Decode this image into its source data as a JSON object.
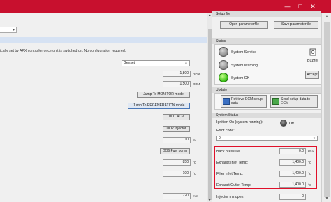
{
  "window": {
    "min_glyph": "—",
    "max_glyph": "□",
    "close_glyph": "✕"
  },
  "left": {
    "info_text": "ically set by APX controller once unit is switched on. No configuration required.",
    "select_value": "Genset",
    "rows": [
      {
        "value": "1,800",
        "unit": "RPM"
      },
      {
        "value": "1,500",
        "unit": "RPM"
      }
    ],
    "jump_monitor": "Jump To MONITOR mode",
    "jump_regeneration": "Jump To REGENERATION mode",
    "do1": "DO1 ACV",
    "do2": "DO2 Injector",
    "percent_value": "10",
    "percent_unit": "%",
    "do6": "DO6 Fuel pump",
    "temp1_value": "850",
    "temp1_unit": "°C",
    "temp2_value": "100",
    "temp2_unit": "°C",
    "bottom_value": "720",
    "bottom_unit": "min"
  },
  "right": {
    "setup_file_title": "Setup file",
    "open_paramfile": "Open parameterfile",
    "save_paramfile": "Save parameterfile",
    "status_title": "Status",
    "system_service": "System Service",
    "system_warning": "System Warning",
    "system_ok": "System OK",
    "buzzer": "Buzzer",
    "accept": "Accept",
    "update_title": "Update",
    "retrieve_ecm": "Retrieve ECM setup data",
    "send_setup": "Send setup data to ECM",
    "system_status_title": "System Status",
    "ignition_label": "Ignition On (system running):",
    "ignition_state": "Off",
    "error_code_label": "Error code:",
    "error_code_value": "0",
    "back_pressure_label": "Back pressure",
    "back_pressure_value": "0.0",
    "back_pressure_unit": "kPa",
    "exhaust_inlet_label": "Exhaust Inlet Temp:",
    "exhaust_inlet_value": "1,400.0",
    "exhaust_inlet_unit": "°C",
    "filter_inlet_label": "Filter Inlet Temp:",
    "filter_inlet_value": "1,400.0",
    "filter_inlet_unit": "°C",
    "exhaust_outlet_label": "Exhaust Outlet Temp:",
    "exhaust_outlet_value": "1,400.0",
    "exhaust_outlet_unit": "°C",
    "injector_label": "Injector ms open:",
    "injector_value": "0"
  },
  "colors": {
    "titlebar": "#c8102e",
    "highlight_box": "#e0102a",
    "system_ok_lamp": "#3fc21a"
  }
}
